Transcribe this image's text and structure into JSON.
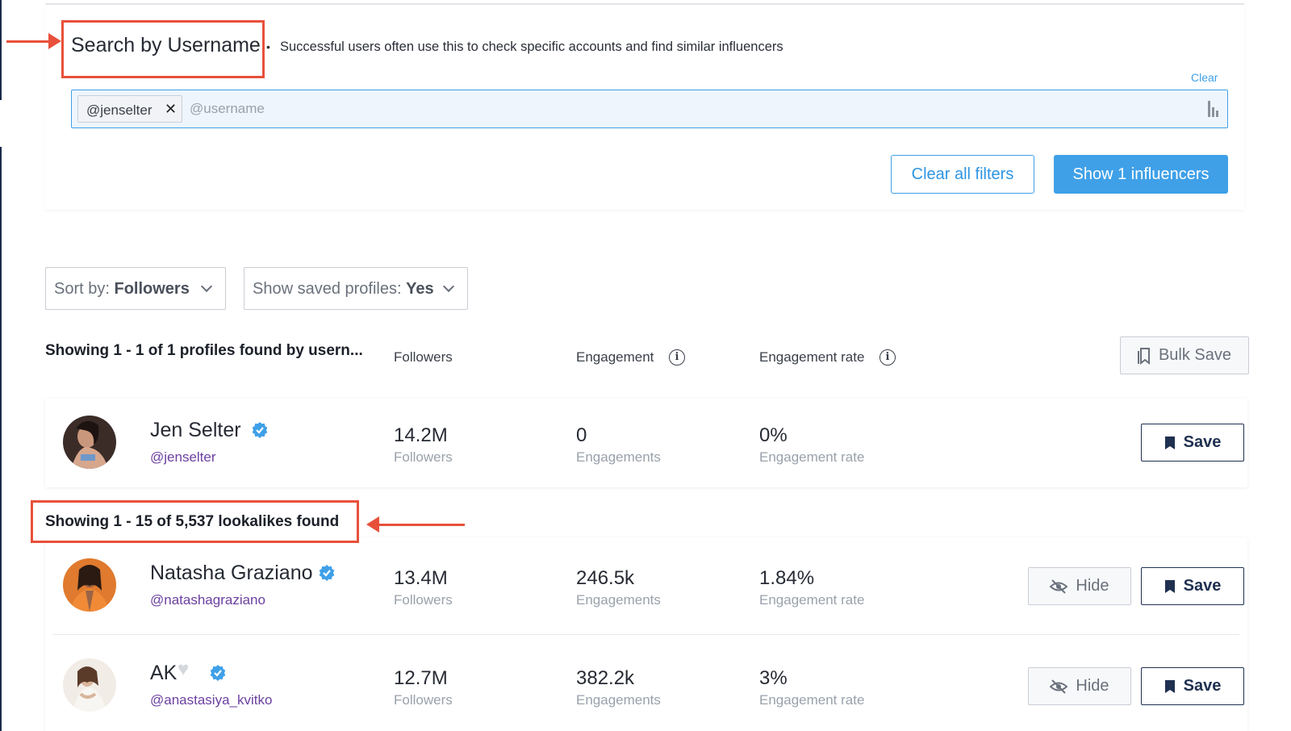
{
  "search_section": {
    "title": "Search by Username",
    "hint": "Successful users often use this to check specific accounts and find similar influencers",
    "clear_link": "Clear",
    "chip": "@jenselter",
    "input_placeholder": "@username",
    "clear_filters_label": "Clear all filters",
    "show_button_label": "Show 1 influencers"
  },
  "controls": {
    "sort_prefix": "Sort by: ",
    "sort_value": "Followers",
    "saved_prefix": "Show saved profiles: ",
    "saved_value": "Yes"
  },
  "results": {
    "heading": "Showing 1 - 1 of 1 profiles found by usern...",
    "columns": {
      "followers": "Followers",
      "engagement": "Engagement",
      "engagement_rate": "Engagement rate"
    },
    "bulk_save_label": "Bulk Save"
  },
  "profile": {
    "name": "Jen Selter",
    "handle": "@jenselter",
    "verified": true,
    "followers": "14.2M",
    "followers_label": "Followers",
    "engagements": "0",
    "engagements_label": "Engagements",
    "engagement_rate": "0%",
    "engagement_rate_label": "Engagement rate",
    "save_label": "Save"
  },
  "lookalikes": {
    "heading": "Showing 1 - 15 of 5,537 lookalikes found",
    "items": [
      {
        "name": "Natasha Graziano",
        "handle": "@natashagraziano",
        "verified": true,
        "followers": "13.4M",
        "followers_label": "Followers",
        "engagements": "246.5k",
        "engagements_label": "Engagements",
        "engagement_rate": "1.84%",
        "engagement_rate_label": "Engagement rate",
        "hide_label": "Hide",
        "save_label": "Save"
      },
      {
        "name": "AK",
        "handle": "@anastasiya_kvitko",
        "verified": true,
        "followers": "12.7M",
        "followers_label": "Followers",
        "engagements": "382.2k",
        "engagements_label": "Engagements",
        "engagement_rate": "3%",
        "engagement_rate_label": "Engagement rate",
        "hide_label": "Hide",
        "save_label": "Save"
      }
    ]
  },
  "colors": {
    "accent": "#3fa0e8",
    "annotation": "#e8503a",
    "handle": "#6b3fa0",
    "save_border": "#1f3050"
  },
  "icons": [
    "chevron-down-icon",
    "info-icon",
    "bookmark-icon",
    "verified-icon",
    "eye-slash-icon",
    "close-icon",
    "white-heart-icon",
    "bars-icon"
  ]
}
